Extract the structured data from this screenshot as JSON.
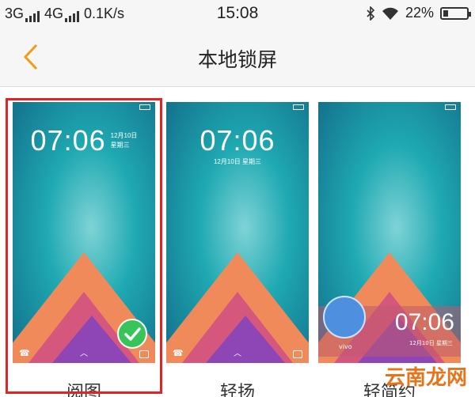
{
  "status_bar": {
    "net1": "3G",
    "net2": "4G",
    "speed": "0.1K/s",
    "time": "15:08",
    "battery": "22%",
    "bluetooth_icon": "bluetooth-icon",
    "wifi_icon": "wifi-icon"
  },
  "nav": {
    "title": "本地锁屏",
    "back_icon": "chevron-left-icon",
    "accent": "#f29b1b"
  },
  "styles": [
    {
      "label": "阅图",
      "time": "07:06",
      "date1": "12月10日",
      "date2": "星期三",
      "selected": true
    },
    {
      "label": "轻扬",
      "time": "07:06",
      "date1": "12月10日 星期三",
      "selected": false
    },
    {
      "label": "轻简约",
      "time": "07:06",
      "date1": "12月10日",
      "date2": "星期三",
      "brand": "vivo",
      "selected": false
    }
  ],
  "selection_color": "#e62222",
  "watermark": "云南龙网"
}
